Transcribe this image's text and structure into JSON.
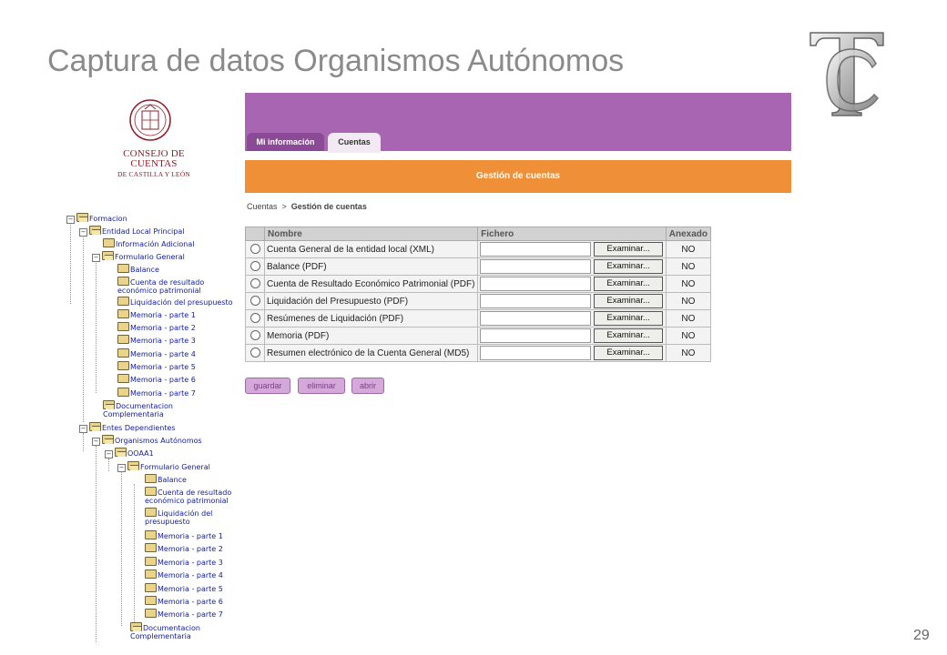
{
  "slide": {
    "title": "Captura de datos Organismos Autónomos",
    "page_number": "29",
    "logo_letters": "TC"
  },
  "org": {
    "name_line1": "CONSEJO DE CUENTAS",
    "name_line2": "DE CASTILLA Y LEÓN"
  },
  "tree": {
    "formacion": "Formacion",
    "entidad_local": "Entidad Local Principal",
    "info_adicional": "Información Adicional",
    "formulario_general": "Formulario General",
    "balance": "Balance",
    "cuenta_resultado": "Cuenta de resultado económico patrimonial",
    "liquidacion": "Liquidación del presupuesto",
    "memoria_1": "Memoria - parte 1",
    "memoria_2": "Memoria - parte 2",
    "memoria_3": "Memoria - parte 3",
    "memoria_4": "Memoria - parte 4",
    "memoria_5": "Memoria - parte 5",
    "memoria_6": "Memoria - parte 6",
    "memoria_7": "Memoria - parte 7",
    "documentacion": "Documentacion Complementaria",
    "entes_dependientes": "Entes Dependientes",
    "organismos_autonomos": "Organismos Autónomos",
    "ooaa1": "OOAA1",
    "formulario_general_2": "Formulario General",
    "balance_2": "Balance",
    "cuenta_resultado_2": "Cuenta de resultado económico patrimonial",
    "liquidacion_2": "Liquidación del presupuesto",
    "memoria_1_2": "Memoria - parte 1",
    "memoria_2_2": "Memoria - parte 2",
    "memoria_3_2": "Memoria - parte 3",
    "memoria_4_2": "Memoria - parte 4",
    "memoria_5_2": "Memoria - parte 5",
    "memoria_6_2": "Memoria - parte 6",
    "memoria_7_2": "Memoria - parte 7",
    "documentacion_2": "Documentacion Complementaria"
  },
  "tabs": {
    "mi_informacion": "Mi información",
    "cuentas": "Cuentas"
  },
  "section_title": "Gestión de cuentas",
  "breadcrumb": {
    "root": "Cuentas",
    "separator": ">",
    "current": "Gestión de cuentas"
  },
  "table": {
    "headers": {
      "nombre": "Nombre",
      "fichero": "Fichero",
      "anexado": "Anexado"
    },
    "browse_label": "Examinar...",
    "rows": [
      {
        "nombre": "Cuenta General de la entidad local (XML)",
        "anexado": "NO"
      },
      {
        "nombre": "Balance (PDF)",
        "anexado": "NO"
      },
      {
        "nombre": "Cuenta de Resultado Económico Patrimonial (PDF)",
        "anexado": "NO"
      },
      {
        "nombre": "Liquidación del Presupuesto (PDF)",
        "anexado": "NO"
      },
      {
        "nombre": "Resúmenes de Liquidación (PDF)",
        "anexado": "NO"
      },
      {
        "nombre": "Memoria (PDF)",
        "anexado": "NO"
      },
      {
        "nombre": "Resumen electrónico de la Cuenta General (MD5)",
        "anexado": "NO"
      }
    ]
  },
  "actions": {
    "guardar": "guardar",
    "eliminar": "eliminar",
    "abrir": "abrir"
  },
  "colors": {
    "header_purple": "#a865b1",
    "orange_bar": "#ef9038",
    "tree_link": "#16209a",
    "org_red": "#8c1f2a"
  }
}
